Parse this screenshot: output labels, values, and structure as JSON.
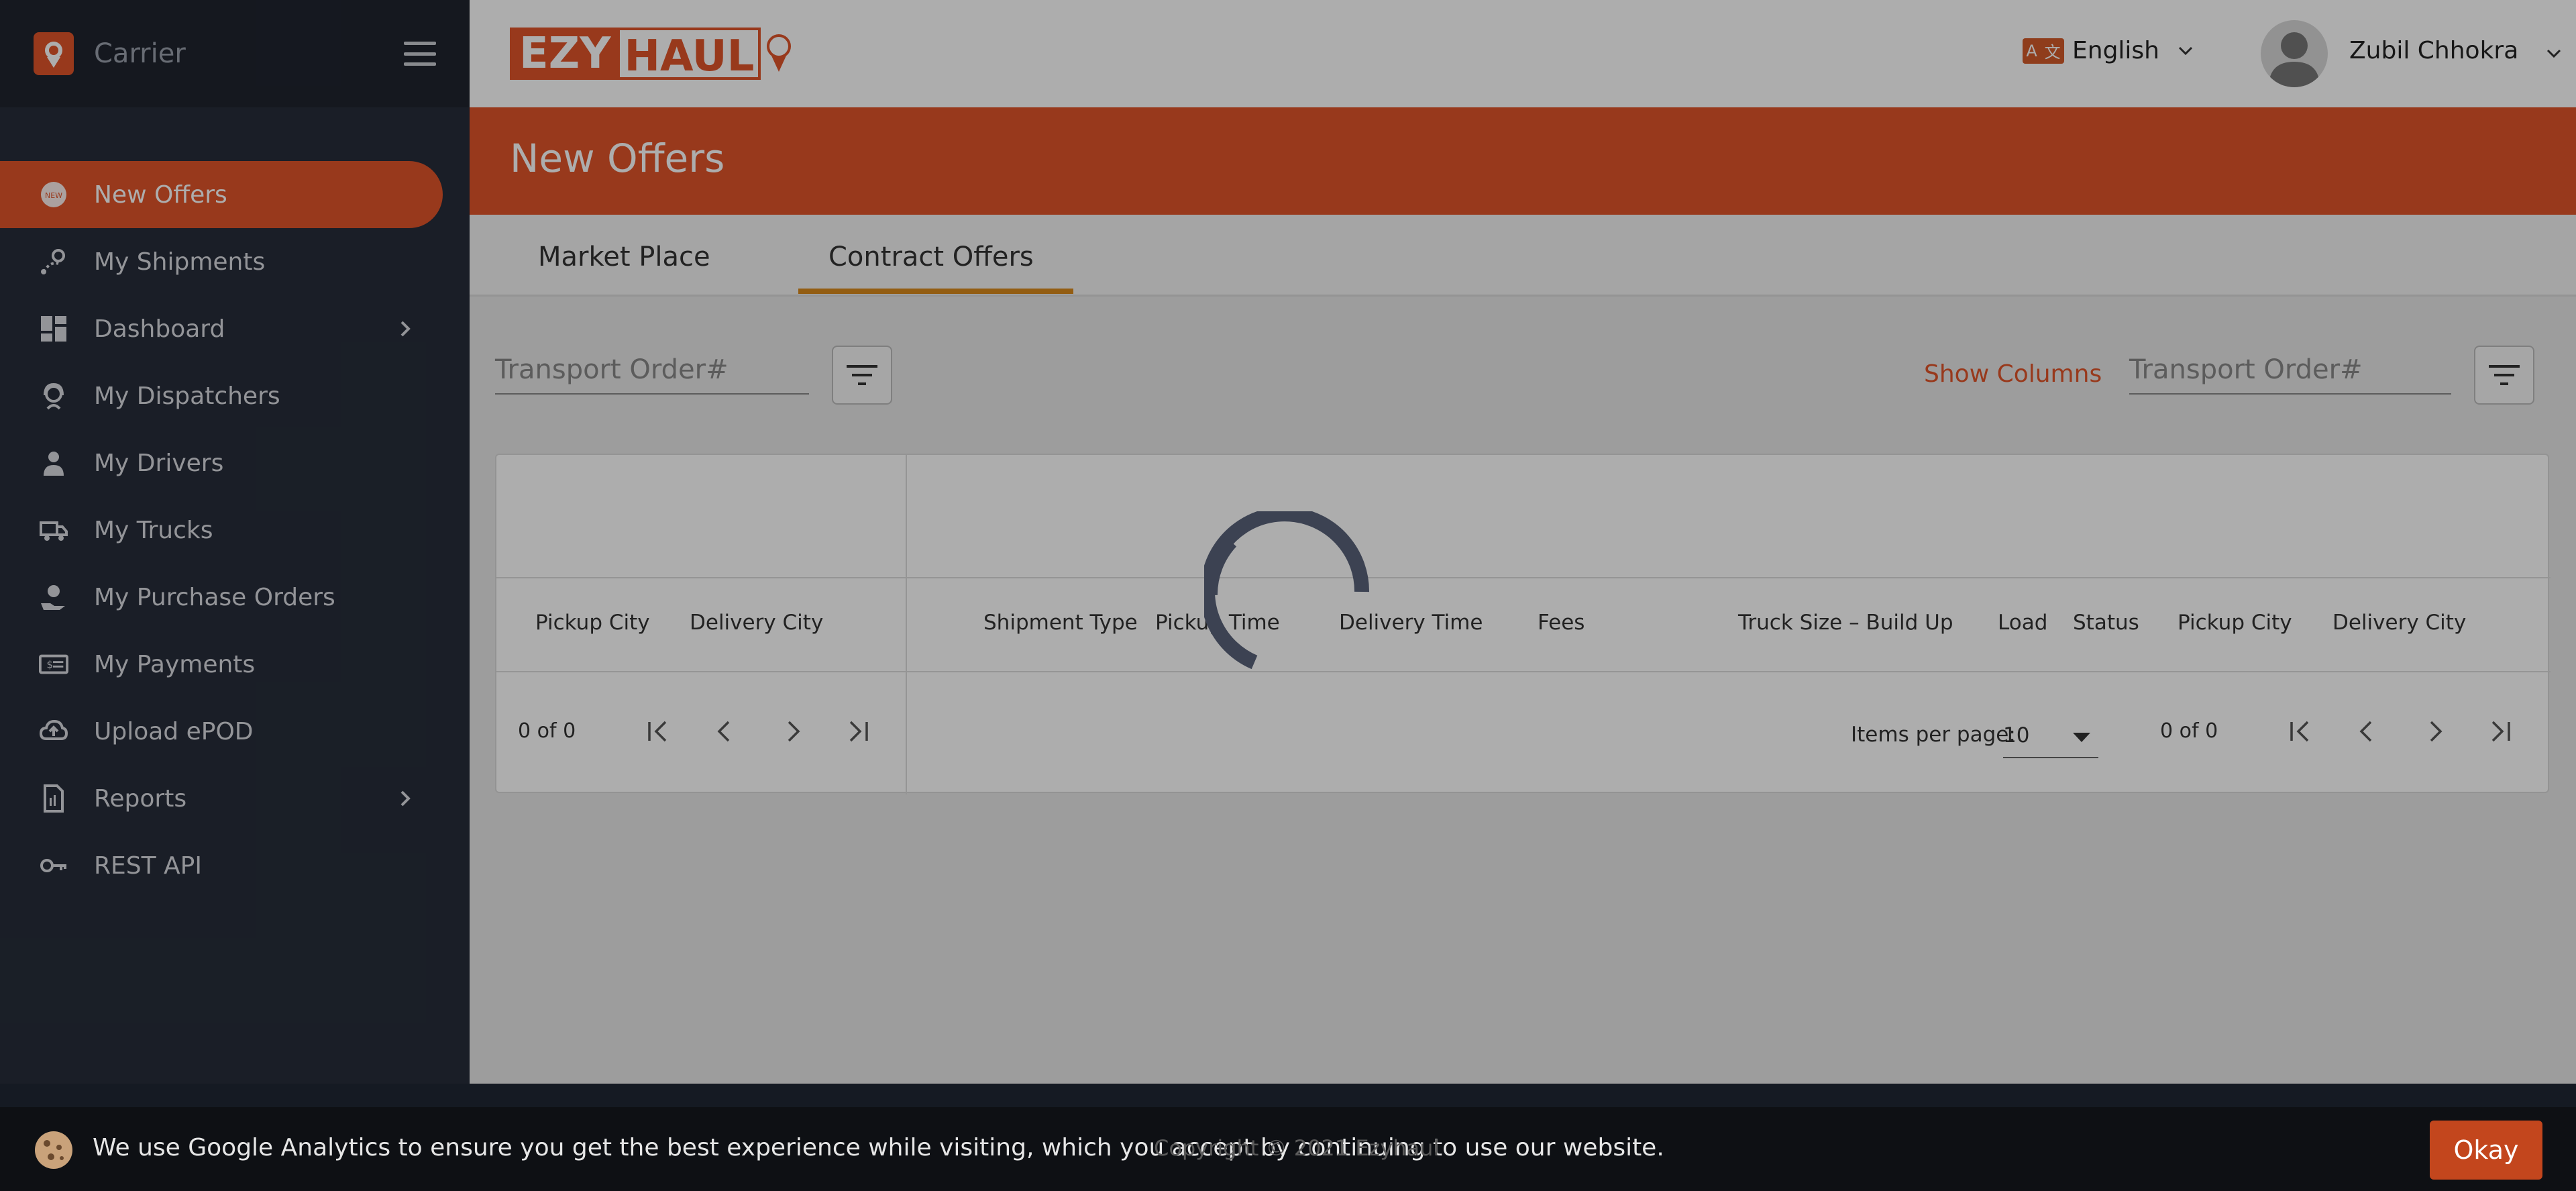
{
  "sidebar": {
    "brand": "Carrier",
    "items": [
      {
        "label": "New Offers",
        "icon": "new-badge-icon",
        "active": true
      },
      {
        "label": "My Shipments",
        "icon": "route-pin-icon"
      },
      {
        "label": "Dashboard",
        "icon": "dashboard-grid-icon",
        "has_submenu": true
      },
      {
        "label": "My Dispatchers",
        "icon": "headset-person-icon"
      },
      {
        "label": "My Drivers",
        "icon": "driver-person-icon"
      },
      {
        "label": "My Trucks",
        "icon": "truck-icon"
      },
      {
        "label": "My Purchase Orders",
        "icon": "hand-money-icon"
      },
      {
        "label": "My Payments",
        "icon": "banknote-icon"
      },
      {
        "label": "Upload ePOD",
        "icon": "cloud-upload-icon"
      },
      {
        "label": "Reports",
        "icon": "report-doc-icon",
        "has_submenu": true
      },
      {
        "label": "REST API",
        "icon": "key-icon"
      }
    ]
  },
  "header": {
    "logo_left": "EZY",
    "logo_right": "HAUL",
    "language": "English",
    "user_name": "Zubil Chhokra"
  },
  "page": {
    "title": "New Offers",
    "tabs": [
      {
        "label": "Market Place",
        "active": false
      },
      {
        "label": "Contract Offers",
        "active": true
      }
    ]
  },
  "filters": {
    "left_placeholder": "Transport Order#",
    "right_placeholder": "Transport Order#",
    "show_columns": "Show Columns"
  },
  "left_table": {
    "columns": [
      "Pickup City",
      "Delivery City"
    ],
    "count": "0 of 0"
  },
  "right_table": {
    "columns": [
      "Shipment Type",
      "Pickup Time",
      "Delivery Time",
      "Fees",
      "Truck Size – Build Up",
      "Load",
      "Status",
      "Pickup City",
      "Delivery City"
    ],
    "items_per_page_label": "Items per page:",
    "items_per_page_value": "10",
    "count": "0 of 0"
  },
  "footer": {
    "copyright": "Copyright © 2021 Ezyhaul",
    "cookie_text": "We use Google Analytics to ensure you get the best experience while visiting, which you accept by continuing to use our website.",
    "cookie_button": "Okay"
  },
  "colors": {
    "accent": "#e0542a",
    "sidebar_bg": "#272d3a",
    "tab_underline": "#d98a1b"
  }
}
